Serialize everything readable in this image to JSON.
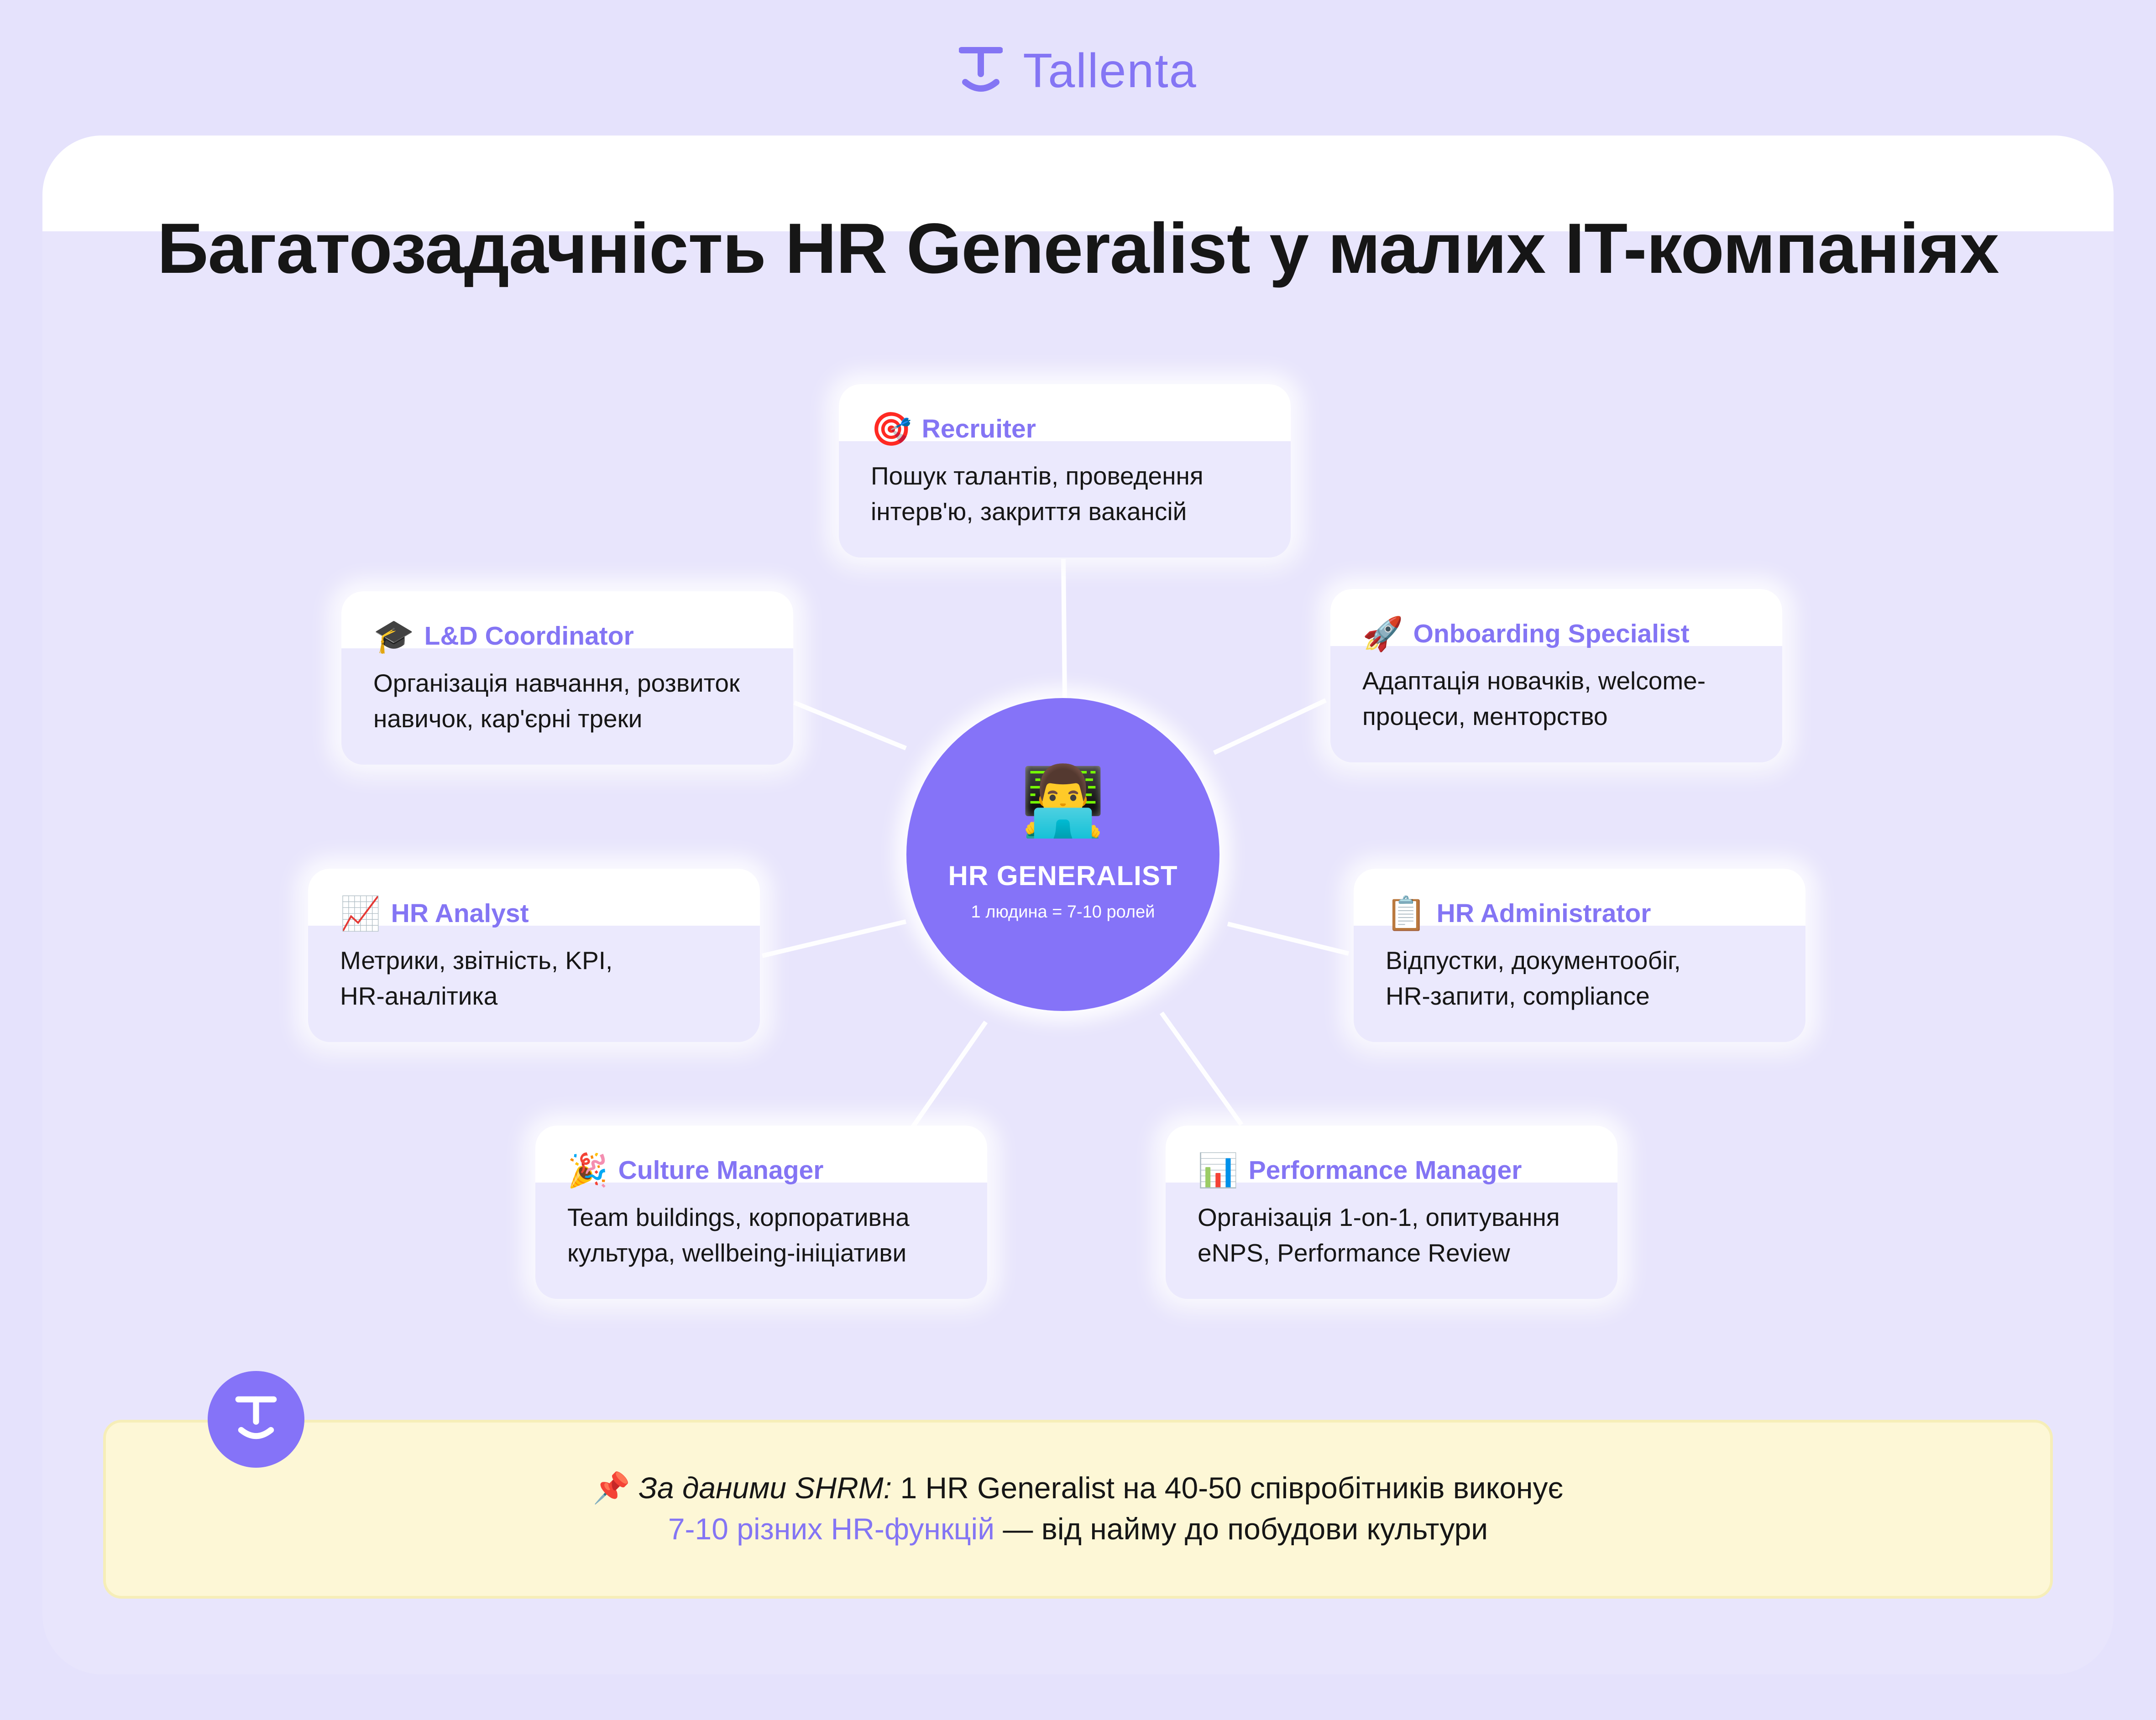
{
  "brand": {
    "name": "Tallenta",
    "logo_icon": "tallenta-logo-icon"
  },
  "title": "Багатозадачність HR Generalist у малих IT-компаніях",
  "colors": {
    "accent": "#8475f4",
    "background": "#e5e2fc",
    "note_bg": "#fdf7d6",
    "text": "#161616"
  },
  "center": {
    "icon": "👨‍💻",
    "title": "HR GENERALIST",
    "subtitle": "1 людина = 7-10 ролей"
  },
  "roles": [
    {
      "icon": "🎯",
      "title": "Recruiter",
      "desc_1": "Пошук талантів, проведення",
      "desc_2": "інтерв'ю, закриття вакансій"
    },
    {
      "icon": "🎓",
      "title": "L&D Coordinator",
      "desc_1": "Організація навчання, розвиток",
      "desc_2": "навичок, кар'єрні треки"
    },
    {
      "icon": "🚀",
      "title": "Onboarding Specialist",
      "desc_1": "Адаптація новачків, welcome-",
      "desc_2": "процеси, менторство"
    },
    {
      "icon": "📈",
      "title": "HR Analyst",
      "desc_1": "Метрики, звітність, KPI,",
      "desc_2": "HR-аналітика"
    },
    {
      "icon": "📋",
      "title": "HR Administrator",
      "desc_1": "Відпустки, документообіг,",
      "desc_2": "HR-запити, compliance"
    },
    {
      "icon": "🎉",
      "title": "Culture Manager",
      "desc_1": "Team buildings, корпоративна",
      "desc_2": "культура, wellbeing-ініціативи"
    },
    {
      "icon": "📊",
      "title": "Performance Manager",
      "desc_1": "Організація 1-on-1, опитування",
      "desc_2": "eNPS, Performance Review"
    }
  ],
  "note": {
    "pin_icon": "📌",
    "source": "За даними SHRM:",
    "line1_rest": " 1 HR Generalist на 40-50 співробітників виконує",
    "highlight": "7-10 різних HR-функцій",
    "line2_rest": " — від найму до побудови культури"
  }
}
